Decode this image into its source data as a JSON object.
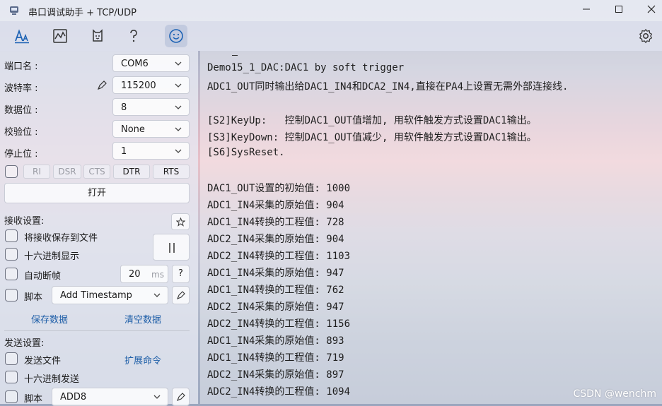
{
  "window": {
    "title": "串口调试助手 + TCP/UDP"
  },
  "toolbar": {
    "icons": [
      "font-icon",
      "chart-icon",
      "dog-icon",
      "help-icon",
      "smile-icon",
      "gear-icon"
    ]
  },
  "serial": {
    "port_label": "端口名 :",
    "port_value": "COM6",
    "baud_label": "波特率 :",
    "baud_value": "115200",
    "data_label": "数据位 :",
    "data_value": "8",
    "parity_label": "校验位 :",
    "parity_value": "None",
    "stop_label": "停止位 :",
    "stop_value": "1"
  },
  "pins": {
    "ri": "RI",
    "dsr": "DSR",
    "cts": "CTS",
    "dtr": "DTR",
    "rts": "RTS"
  },
  "open_button": "打开",
  "receive": {
    "heading": "接收设置:",
    "save_to_file": "将接收保存到文件",
    "hex_display": "十六进制显示",
    "auto_frame": "自动断帧",
    "frame_value": "20",
    "frame_unit": "ms",
    "help": "?",
    "script_label": "脚本",
    "script_value": "Add Timestamp",
    "save_data": "保存数据",
    "clear_data": "清空数据"
  },
  "send": {
    "heading": "发送设置:",
    "send_file": "发送文件",
    "ext_command": "扩展命令",
    "hex_send": "十六进制发送",
    "script_label": "脚本",
    "script_value": "ADD8"
  },
  "terminal": {
    "lines": [
      "Demo15_1_DAC:DAC1 by soft trigger",
      "ADC1_OUT同时输出给DAC1_IN4和DCA2_IN4,直接在PA4上设置无需外部连接线.",
      "",
      "[S2]KeyUp:   控制DAC1_OUT值增加, 用软件触发方式设置DAC1输出。",
      "[S3]KeyDown: 控制DAC1_OUT值减少, 用软件触发方式设置DAC1输出。",
      "[S6]SysReset.",
      "",
      "DAC1_OUT设置的初始值: 1000",
      "ADC1_IN4采集的原始值: 904",
      "ADC1_IN4转换的工程值: 728",
      "ADC2_IN4采集的原始值: 904",
      "ADC2_IN4转换的工程值: 1103",
      "ADC1_IN4采集的原始值: 947",
      "ADC1_IN4转换的工程值: 762",
      "ADC2_IN4采集的原始值: 947",
      "ADC2_IN4转换的工程值: 1156",
      "ADC1_IN4采集的原始值: 893",
      "ADC1_IN4转换的工程值: 719",
      "ADC2_IN4采集的原始值: 897",
      "ADC2_IN4转换的工程值: 1094"
    ]
  },
  "watermark": "CSDN @wenchm"
}
